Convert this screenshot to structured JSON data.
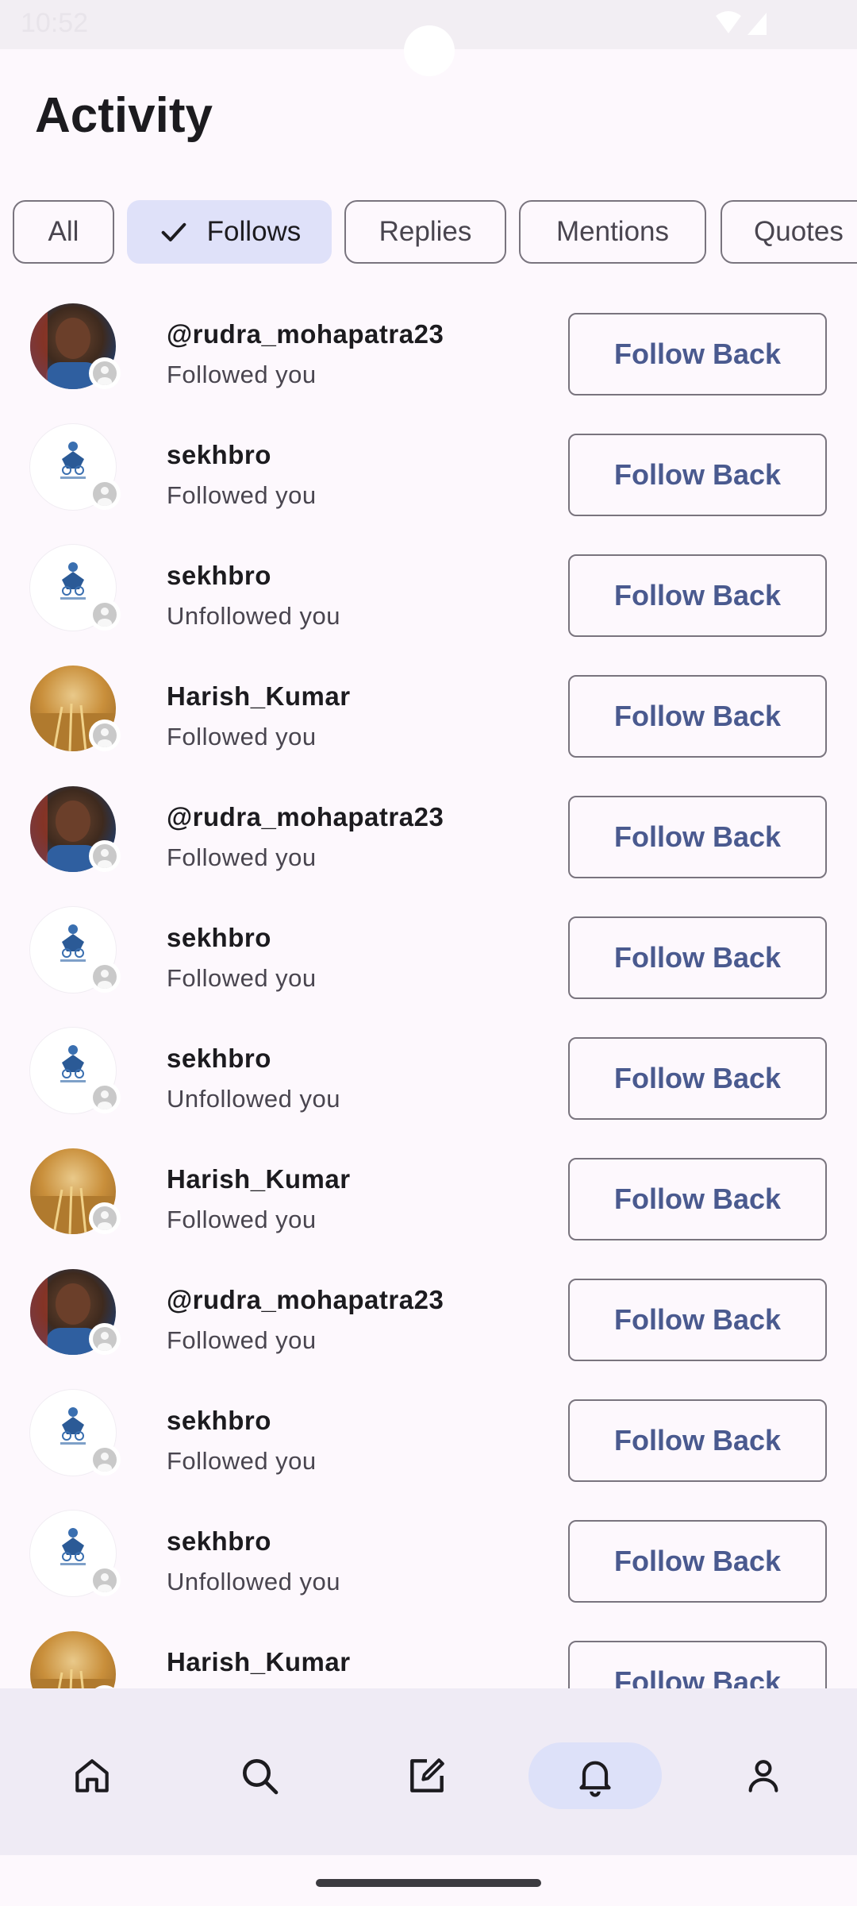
{
  "status_bar": {
    "time": "10:52"
  },
  "page": {
    "title": "Activity"
  },
  "filters": [
    {
      "label": "All",
      "selected": false
    },
    {
      "label": "Follows",
      "selected": true
    },
    {
      "label": "Replies",
      "selected": false
    },
    {
      "label": "Mentions",
      "selected": false
    },
    {
      "label": "Quotes",
      "selected": false
    }
  ],
  "activity": [
    {
      "name": "@rudra_mohapatra23",
      "status": "Followed you",
      "avatar": "person",
      "action": "Follow Back"
    },
    {
      "name": "sekhbro",
      "status": "Followed you",
      "avatar": "logo",
      "action": "Follow Back"
    },
    {
      "name": "sekhbro",
      "status": "Unfollowed you",
      "avatar": "logo",
      "action": "Follow Back"
    },
    {
      "name": "Harish_Kumar",
      "status": "Followed you",
      "avatar": "field",
      "action": "Follow Back"
    },
    {
      "name": "@rudra_mohapatra23",
      "status": "Followed you",
      "avatar": "person",
      "action": "Follow Back"
    },
    {
      "name": "sekhbro",
      "status": "Followed you",
      "avatar": "logo",
      "action": "Follow Back"
    },
    {
      "name": "sekhbro",
      "status": "Unfollowed you",
      "avatar": "logo",
      "action": "Follow Back"
    },
    {
      "name": "Harish_Kumar",
      "status": "Followed you",
      "avatar": "field",
      "action": "Follow Back"
    },
    {
      "name": "@rudra_mohapatra23",
      "status": "Followed you",
      "avatar": "person",
      "action": "Follow Back"
    },
    {
      "name": "sekhbro",
      "status": "Followed you",
      "avatar": "logo",
      "action": "Follow Back"
    },
    {
      "name": "sekhbro",
      "status": "Unfollowed you",
      "avatar": "logo",
      "action": "Follow Back"
    },
    {
      "name": "Harish_Kumar",
      "status": "",
      "avatar": "field",
      "action": "Follow Back"
    }
  ],
  "bottom_nav": [
    {
      "icon": "home-icon",
      "active": false
    },
    {
      "icon": "search-icon",
      "active": false
    },
    {
      "icon": "compose-icon",
      "active": false
    },
    {
      "icon": "bell-icon",
      "active": true
    },
    {
      "icon": "profile-icon",
      "active": false
    }
  ],
  "colors": {
    "background": "#fdf8fd",
    "selected_chip": "#dfe1f9",
    "follow_text": "#4a5a8f",
    "nav_background": "#efebf5",
    "nav_active": "#dde1f9"
  }
}
